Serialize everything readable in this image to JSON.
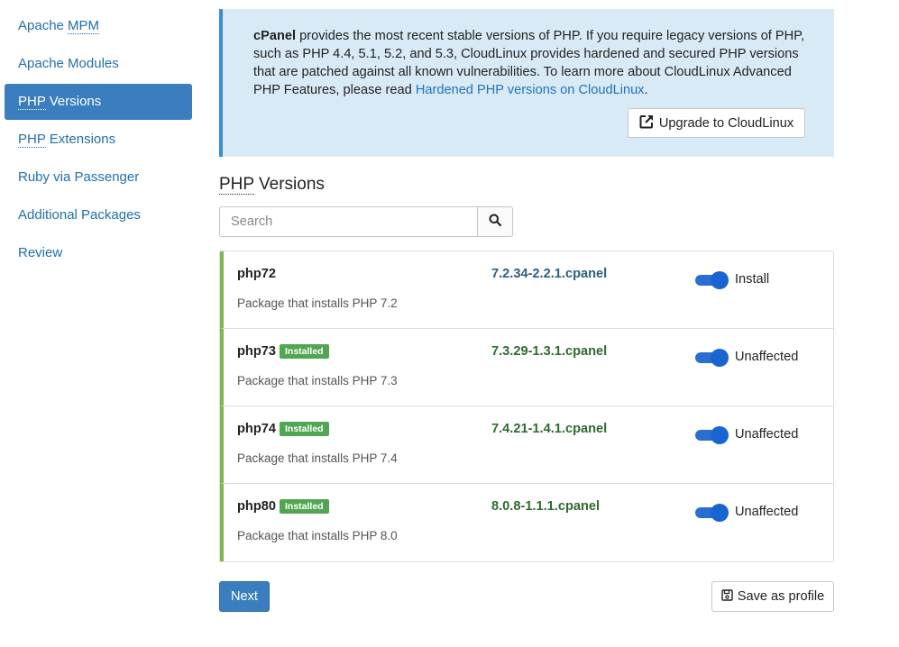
{
  "sidebar": {
    "items": [
      {
        "prefix": "Apache ",
        "abbr": "MPM",
        "suffix": "",
        "active": false
      },
      {
        "prefix": "Apache Modules",
        "abbr": "",
        "suffix": "",
        "active": false
      },
      {
        "prefix": "",
        "abbr": "PHP",
        "suffix": " Versions",
        "active": true
      },
      {
        "prefix": "",
        "abbr": "PHP",
        "suffix": " Extensions",
        "active": false
      },
      {
        "prefix": "Ruby via Passenger",
        "abbr": "",
        "suffix": "",
        "active": false
      },
      {
        "prefix": "Additional Packages",
        "abbr": "",
        "suffix": "",
        "active": false
      },
      {
        "prefix": "Review",
        "abbr": "",
        "suffix": "",
        "active": false
      }
    ]
  },
  "info": {
    "brand": "cPanel",
    "text": " provides the most recent stable versions of PHP. If you require legacy versions of PHP, such as PHP 4.4, 5.1, 5.2, and 5.3, CloudLinux provides hardened and secured PHP versions that are patched against all known vulnerabilities. To learn more about CloudLinux Advanced PHP Features, please read ",
    "link": "Hardened PHP versions on CloudLinux",
    "end": ".",
    "upgrade_label": "Upgrade to CloudLinux"
  },
  "section": {
    "title_abbr": "PHP",
    "title_rest": " Versions"
  },
  "search": {
    "placeholder": "Search",
    "value": ""
  },
  "packages": [
    {
      "name": "php72",
      "badge": "",
      "description": "Package that installs PHP 7.2",
      "version": "7.2.34-2.2.1.cpanel",
      "toggle_label": "Install",
      "version_color": "#2c5f7c",
      "toggle_on": true
    },
    {
      "name": "php73",
      "badge": "Installed",
      "description": "Package that installs PHP 7.3",
      "version": "7.3.29-1.3.1.cpanel",
      "toggle_label": "Unaffected",
      "version_color": "#2e6b2e",
      "toggle_on": true
    },
    {
      "name": "php74",
      "badge": "Installed",
      "description": "Package that installs PHP 7.4",
      "version": "7.4.21-1.4.1.cpanel",
      "toggle_label": "Unaffected",
      "version_color": "#2e6b2e",
      "toggle_on": true
    },
    {
      "name": "php80",
      "badge": "Installed",
      "description": "Package that installs PHP 8.0",
      "version": "8.0.8-1.1.1.cpanel",
      "toggle_label": "Unaffected",
      "version_color": "#2e6b2e",
      "toggle_on": true
    }
  ],
  "footer": {
    "next_label": "Next",
    "save_label": "Save as profile"
  },
  "colors": {
    "primary": "#3a7ebf",
    "installed_badge": "#52a552",
    "row_accent": "#7fb64f",
    "info_bg": "#d9eaf7",
    "toggle": "#1864d0"
  }
}
